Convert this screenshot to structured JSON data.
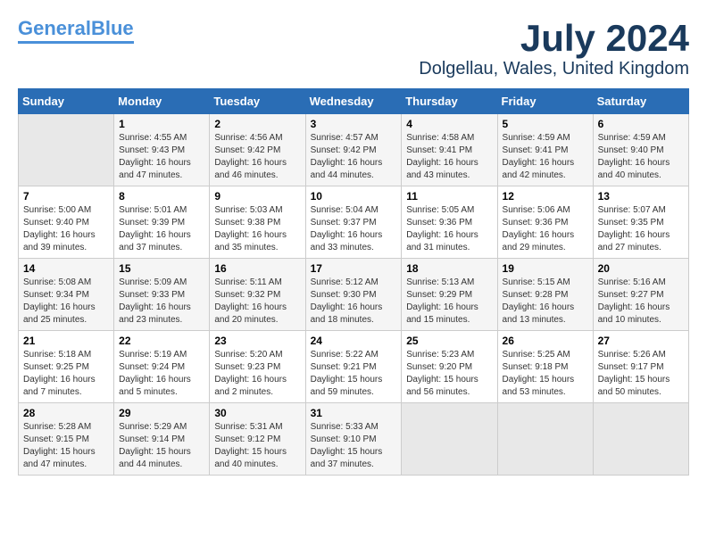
{
  "header": {
    "logo_line1": "General",
    "logo_line2": "Blue",
    "month_year": "July 2024",
    "location": "Dolgellau, Wales, United Kingdom"
  },
  "calendar": {
    "days_of_week": [
      "Sunday",
      "Monday",
      "Tuesday",
      "Wednesday",
      "Thursday",
      "Friday",
      "Saturday"
    ],
    "weeks": [
      [
        {
          "day": "",
          "empty": true
        },
        {
          "day": "1",
          "sunrise": "Sunrise: 4:55 AM",
          "sunset": "Sunset: 9:43 PM",
          "daylight": "Daylight: 16 hours and 47 minutes."
        },
        {
          "day": "2",
          "sunrise": "Sunrise: 4:56 AM",
          "sunset": "Sunset: 9:42 PM",
          "daylight": "Daylight: 16 hours and 46 minutes."
        },
        {
          "day": "3",
          "sunrise": "Sunrise: 4:57 AM",
          "sunset": "Sunset: 9:42 PM",
          "daylight": "Daylight: 16 hours and 44 minutes."
        },
        {
          "day": "4",
          "sunrise": "Sunrise: 4:58 AM",
          "sunset": "Sunset: 9:41 PM",
          "daylight": "Daylight: 16 hours and 43 minutes."
        },
        {
          "day": "5",
          "sunrise": "Sunrise: 4:59 AM",
          "sunset": "Sunset: 9:41 PM",
          "daylight": "Daylight: 16 hours and 42 minutes."
        },
        {
          "day": "6",
          "sunrise": "Sunrise: 4:59 AM",
          "sunset": "Sunset: 9:40 PM",
          "daylight": "Daylight: 16 hours and 40 minutes."
        }
      ],
      [
        {
          "day": "7",
          "sunrise": "Sunrise: 5:00 AM",
          "sunset": "Sunset: 9:40 PM",
          "daylight": "Daylight: 16 hours and 39 minutes."
        },
        {
          "day": "8",
          "sunrise": "Sunrise: 5:01 AM",
          "sunset": "Sunset: 9:39 PM",
          "daylight": "Daylight: 16 hours and 37 minutes."
        },
        {
          "day": "9",
          "sunrise": "Sunrise: 5:03 AM",
          "sunset": "Sunset: 9:38 PM",
          "daylight": "Daylight: 16 hours and 35 minutes."
        },
        {
          "day": "10",
          "sunrise": "Sunrise: 5:04 AM",
          "sunset": "Sunset: 9:37 PM",
          "daylight": "Daylight: 16 hours and 33 minutes."
        },
        {
          "day": "11",
          "sunrise": "Sunrise: 5:05 AM",
          "sunset": "Sunset: 9:36 PM",
          "daylight": "Daylight: 16 hours and 31 minutes."
        },
        {
          "day": "12",
          "sunrise": "Sunrise: 5:06 AM",
          "sunset": "Sunset: 9:36 PM",
          "daylight": "Daylight: 16 hours and 29 minutes."
        },
        {
          "day": "13",
          "sunrise": "Sunrise: 5:07 AM",
          "sunset": "Sunset: 9:35 PM",
          "daylight": "Daylight: 16 hours and 27 minutes."
        }
      ],
      [
        {
          "day": "14",
          "sunrise": "Sunrise: 5:08 AM",
          "sunset": "Sunset: 9:34 PM",
          "daylight": "Daylight: 16 hours and 25 minutes."
        },
        {
          "day": "15",
          "sunrise": "Sunrise: 5:09 AM",
          "sunset": "Sunset: 9:33 PM",
          "daylight": "Daylight: 16 hours and 23 minutes."
        },
        {
          "day": "16",
          "sunrise": "Sunrise: 5:11 AM",
          "sunset": "Sunset: 9:32 PM",
          "daylight": "Daylight: 16 hours and 20 minutes."
        },
        {
          "day": "17",
          "sunrise": "Sunrise: 5:12 AM",
          "sunset": "Sunset: 9:30 PM",
          "daylight": "Daylight: 16 hours and 18 minutes."
        },
        {
          "day": "18",
          "sunrise": "Sunrise: 5:13 AM",
          "sunset": "Sunset: 9:29 PM",
          "daylight": "Daylight: 16 hours and 15 minutes."
        },
        {
          "day": "19",
          "sunrise": "Sunrise: 5:15 AM",
          "sunset": "Sunset: 9:28 PM",
          "daylight": "Daylight: 16 hours and 13 minutes."
        },
        {
          "day": "20",
          "sunrise": "Sunrise: 5:16 AM",
          "sunset": "Sunset: 9:27 PM",
          "daylight": "Daylight: 16 hours and 10 minutes."
        }
      ],
      [
        {
          "day": "21",
          "sunrise": "Sunrise: 5:18 AM",
          "sunset": "Sunset: 9:25 PM",
          "daylight": "Daylight: 16 hours and 7 minutes."
        },
        {
          "day": "22",
          "sunrise": "Sunrise: 5:19 AM",
          "sunset": "Sunset: 9:24 PM",
          "daylight": "Daylight: 16 hours and 5 minutes."
        },
        {
          "day": "23",
          "sunrise": "Sunrise: 5:20 AM",
          "sunset": "Sunset: 9:23 PM",
          "daylight": "Daylight: 16 hours and 2 minutes."
        },
        {
          "day": "24",
          "sunrise": "Sunrise: 5:22 AM",
          "sunset": "Sunset: 9:21 PM",
          "daylight": "Daylight: 15 hours and 59 minutes."
        },
        {
          "day": "25",
          "sunrise": "Sunrise: 5:23 AM",
          "sunset": "Sunset: 9:20 PM",
          "daylight": "Daylight: 15 hours and 56 minutes."
        },
        {
          "day": "26",
          "sunrise": "Sunrise: 5:25 AM",
          "sunset": "Sunset: 9:18 PM",
          "daylight": "Daylight: 15 hours and 53 minutes."
        },
        {
          "day": "27",
          "sunrise": "Sunrise: 5:26 AM",
          "sunset": "Sunset: 9:17 PM",
          "daylight": "Daylight: 15 hours and 50 minutes."
        }
      ],
      [
        {
          "day": "28",
          "sunrise": "Sunrise: 5:28 AM",
          "sunset": "Sunset: 9:15 PM",
          "daylight": "Daylight: 15 hours and 47 minutes."
        },
        {
          "day": "29",
          "sunrise": "Sunrise: 5:29 AM",
          "sunset": "Sunset: 9:14 PM",
          "daylight": "Daylight: 15 hours and 44 minutes."
        },
        {
          "day": "30",
          "sunrise": "Sunrise: 5:31 AM",
          "sunset": "Sunset: 9:12 PM",
          "daylight": "Daylight: 15 hours and 40 minutes."
        },
        {
          "day": "31",
          "sunrise": "Sunrise: 5:33 AM",
          "sunset": "Sunset: 9:10 PM",
          "daylight": "Daylight: 15 hours and 37 minutes."
        },
        {
          "day": "",
          "empty": true
        },
        {
          "day": "",
          "empty": true
        },
        {
          "day": "",
          "empty": true
        }
      ]
    ]
  }
}
